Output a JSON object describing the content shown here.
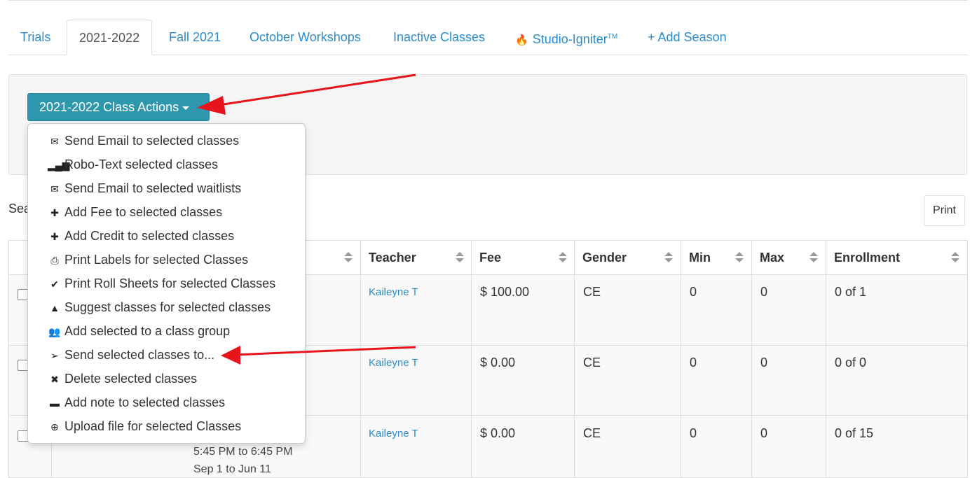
{
  "tabs": [
    "Trials",
    "2021-2022",
    "Fall 2021",
    "October Workshops",
    "Inactive Classes",
    "Studio-Igniter",
    "+ Add Season"
  ],
  "tab_trademark": "TM",
  "actions_button": "2021-2022 Class Actions",
  "menu": [
    {
      "icon": "envelope-icon",
      "label": "Send Email to selected classes"
    },
    {
      "icon": "signal-icon",
      "label": "Robo-Text selected classes"
    },
    {
      "icon": "envelope-icon",
      "label": "Send Email to selected waitlists"
    },
    {
      "icon": "plus-icon",
      "label": "Add Fee to selected classes"
    },
    {
      "icon": "plus-icon",
      "label": "Add Credit to selected classes"
    },
    {
      "icon": "print-icon",
      "label": "Print Labels for selected Classes"
    },
    {
      "icon": "check-circle-icon",
      "label": "Print Roll Sheets for selected Classes"
    },
    {
      "icon": "road-icon",
      "label": "Suggest classes for selected classes"
    },
    {
      "icon": "users-icon",
      "label": "Add selected to a class group"
    },
    {
      "icon": "paper-plane-icon",
      "label": "Send selected classes to..."
    },
    {
      "icon": "times-icon",
      "label": "Delete selected classes"
    },
    {
      "icon": "comment-icon",
      "label": "Add note to selected classes"
    },
    {
      "icon": "upload-icon",
      "label": "Upload file for selected Classes"
    }
  ],
  "search_label_partial": "Sea",
  "print_label": "Print",
  "table": {
    "headers": [
      "Teacher",
      "Fee",
      "Gender",
      "Min",
      "Max",
      "Enrollment"
    ],
    "rows": [
      {
        "teacher": "Kaileyne T",
        "fee": "$ 100.00",
        "gender": "CE",
        "min": "0",
        "max": "0",
        "enrollment": "0 of 1"
      },
      {
        "teacher": "Kaileyne T",
        "fee": "$ 0.00",
        "gender": "CE",
        "min": "0",
        "max": "0",
        "enrollment": "0 of 0"
      },
      {
        "teacher": "Kaileyne T",
        "fee": "$ 0.00",
        "gender": "CE",
        "min": "0",
        "max": "0",
        "enrollment": "0 of 15",
        "time": "5:45 PM to 6:45 PM",
        "dates": "Sep 1 to Jun 11"
      }
    ]
  },
  "colors": {
    "link": "#2a8ccf",
    "button": "#2f97ad",
    "arrow": "#e8141c"
  }
}
